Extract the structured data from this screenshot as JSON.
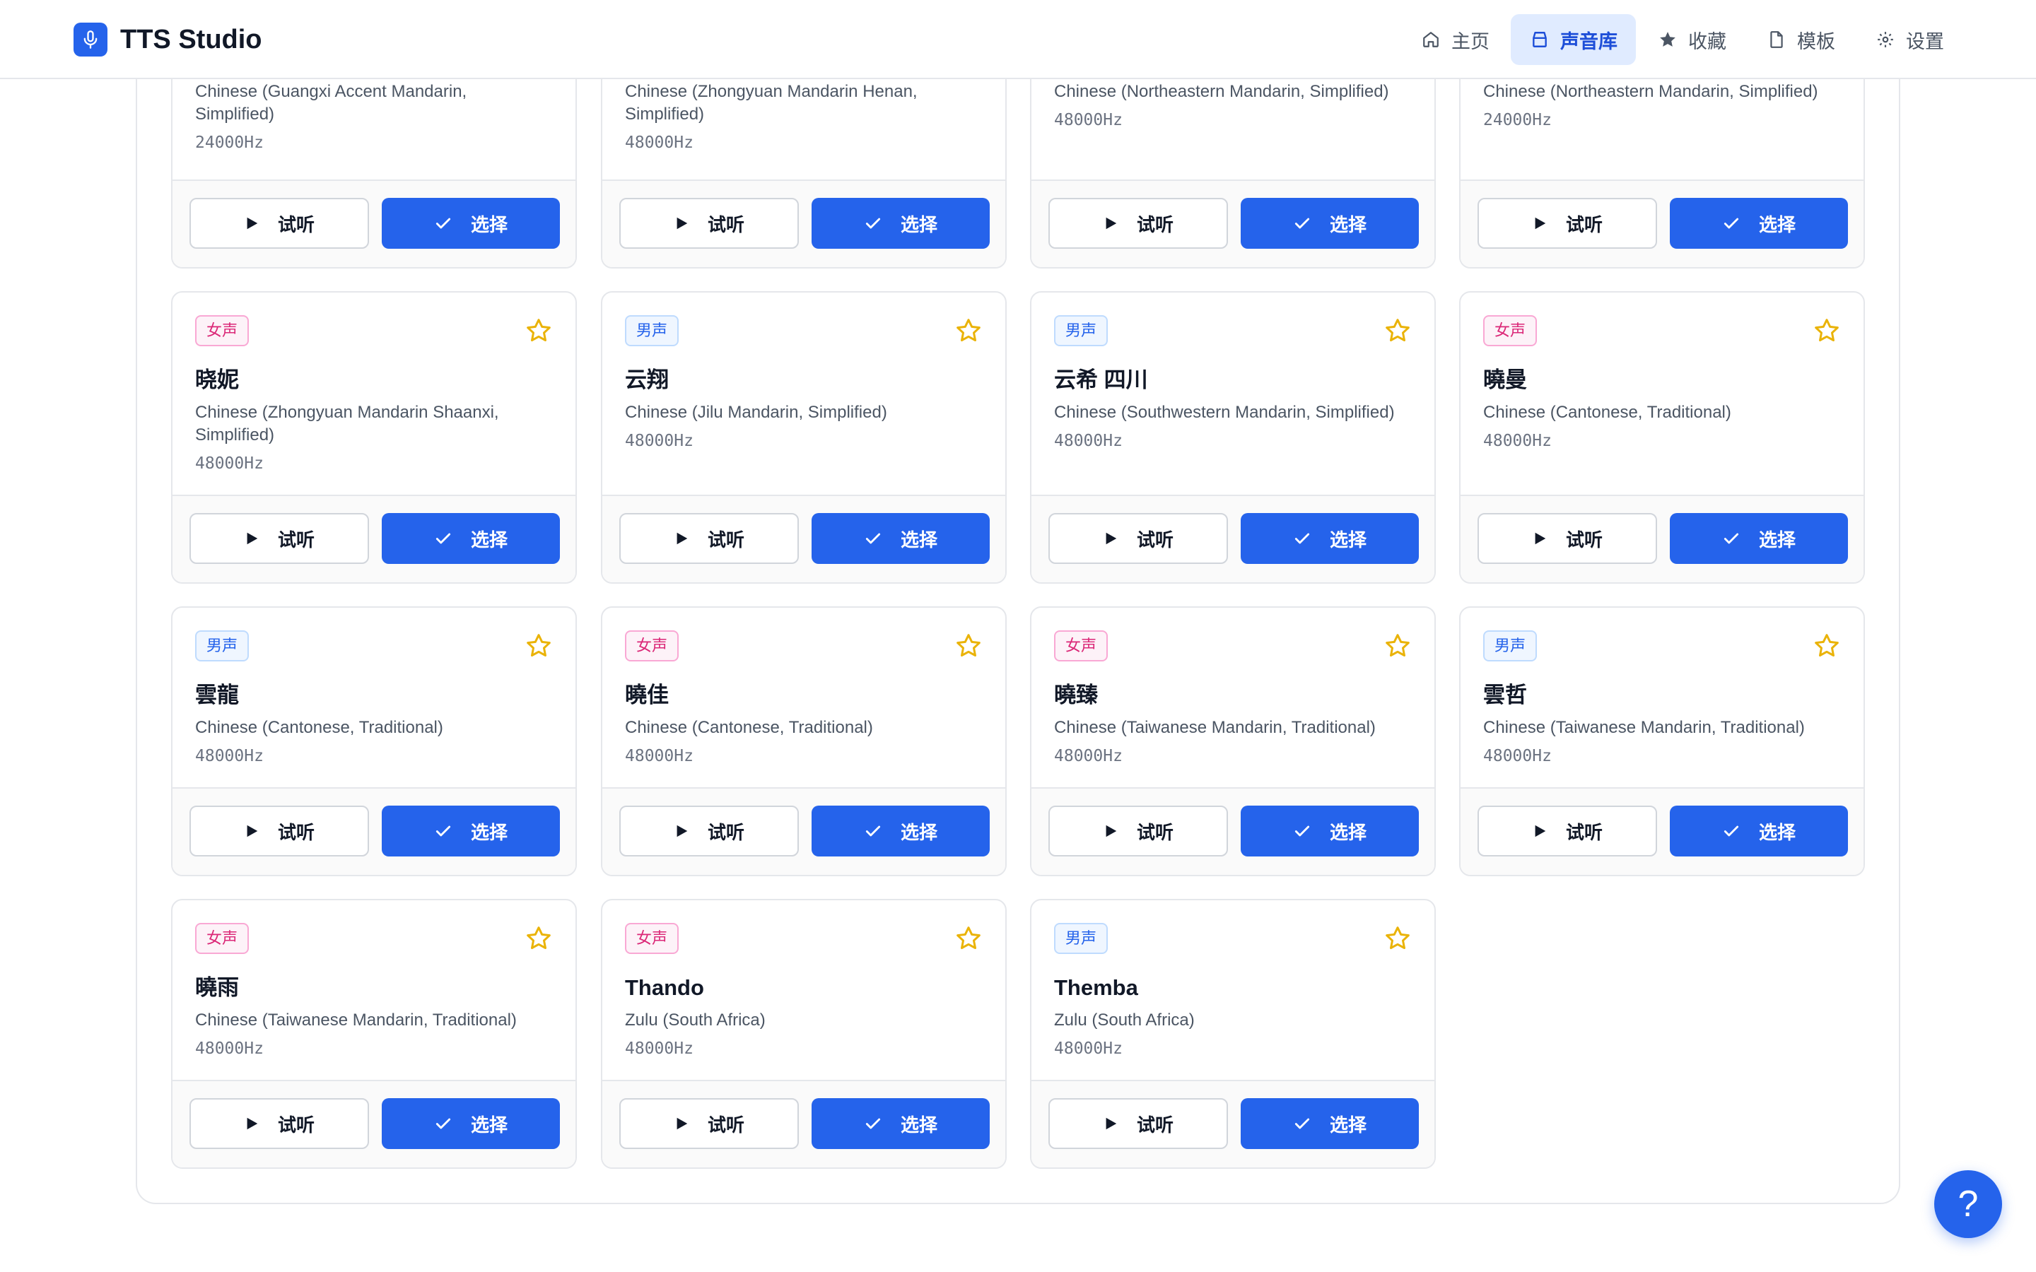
{
  "app": {
    "title": "TTS Studio",
    "logo_icon": "microphone-icon",
    "accent_color": "#2563eb"
  },
  "nav": {
    "items": [
      {
        "label": "主页",
        "icon": "home-icon",
        "active": false
      },
      {
        "label": "声音库",
        "icon": "library-icon",
        "active": true
      },
      {
        "label": "收藏",
        "icon": "star-icon",
        "active": false
      },
      {
        "label": "模板",
        "icon": "document-icon",
        "active": false
      },
      {
        "label": "设置",
        "icon": "gear-icon",
        "active": false
      }
    ]
  },
  "buttons": {
    "preview_label": "试听",
    "select_label": "选择"
  },
  "voices": [
    {
      "badge": "",
      "name": "",
      "lang": "Chinese (Guangxi Accent Mandarin, Simplified)",
      "rate": "24000Hz",
      "partial": true
    },
    {
      "badge": "",
      "name": "",
      "lang": "Chinese (Zhongyuan Mandarin Henan, Simplified)",
      "rate": "48000Hz",
      "partial": true
    },
    {
      "badge": "",
      "name": "",
      "lang": "Chinese (Northeastern Mandarin, Simplified)",
      "rate": "48000Hz",
      "partial": true
    },
    {
      "badge": "",
      "name": "",
      "lang": "Chinese (Northeastern Mandarin, Simplified)",
      "rate": "24000Hz",
      "partial": true
    },
    {
      "badge": "女声",
      "gender": "female",
      "name": "晓妮",
      "lang": "Chinese (Zhongyuan Mandarin Shaanxi, Simplified)",
      "rate": "48000Hz"
    },
    {
      "badge": "男声",
      "gender": "male",
      "name": "云翔",
      "lang": "Chinese (Jilu Mandarin, Simplified)",
      "rate": "48000Hz"
    },
    {
      "badge": "男声",
      "gender": "male",
      "name": "云希 四川",
      "lang": "Chinese (Southwestern Mandarin, Simplified)",
      "rate": "48000Hz"
    },
    {
      "badge": "女声",
      "gender": "female",
      "name": "曉曼",
      "lang": "Chinese (Cantonese, Traditional)",
      "rate": "48000Hz"
    },
    {
      "badge": "男声",
      "gender": "male",
      "name": "雲龍",
      "lang": "Chinese (Cantonese, Traditional)",
      "rate": "48000Hz"
    },
    {
      "badge": "女声",
      "gender": "female",
      "name": "曉佳",
      "lang": "Chinese (Cantonese, Traditional)",
      "rate": "48000Hz"
    },
    {
      "badge": "女声",
      "gender": "female",
      "name": "曉臻",
      "lang": "Chinese (Taiwanese Mandarin, Traditional)",
      "rate": "48000Hz"
    },
    {
      "badge": "男声",
      "gender": "male",
      "name": "雲哲",
      "lang": "Chinese (Taiwanese Mandarin, Traditional)",
      "rate": "48000Hz"
    },
    {
      "badge": "女声",
      "gender": "female",
      "name": "曉雨",
      "lang": "Chinese (Taiwanese Mandarin, Traditional)",
      "rate": "48000Hz"
    },
    {
      "badge": "女声",
      "gender": "female",
      "name": "Thando",
      "lang": "Zulu (South Africa)",
      "rate": "48000Hz"
    },
    {
      "badge": "男声",
      "gender": "male",
      "name": "Themba",
      "lang": "Zulu (South Africa)",
      "rate": "48000Hz"
    }
  ],
  "help": {
    "label": "?"
  }
}
